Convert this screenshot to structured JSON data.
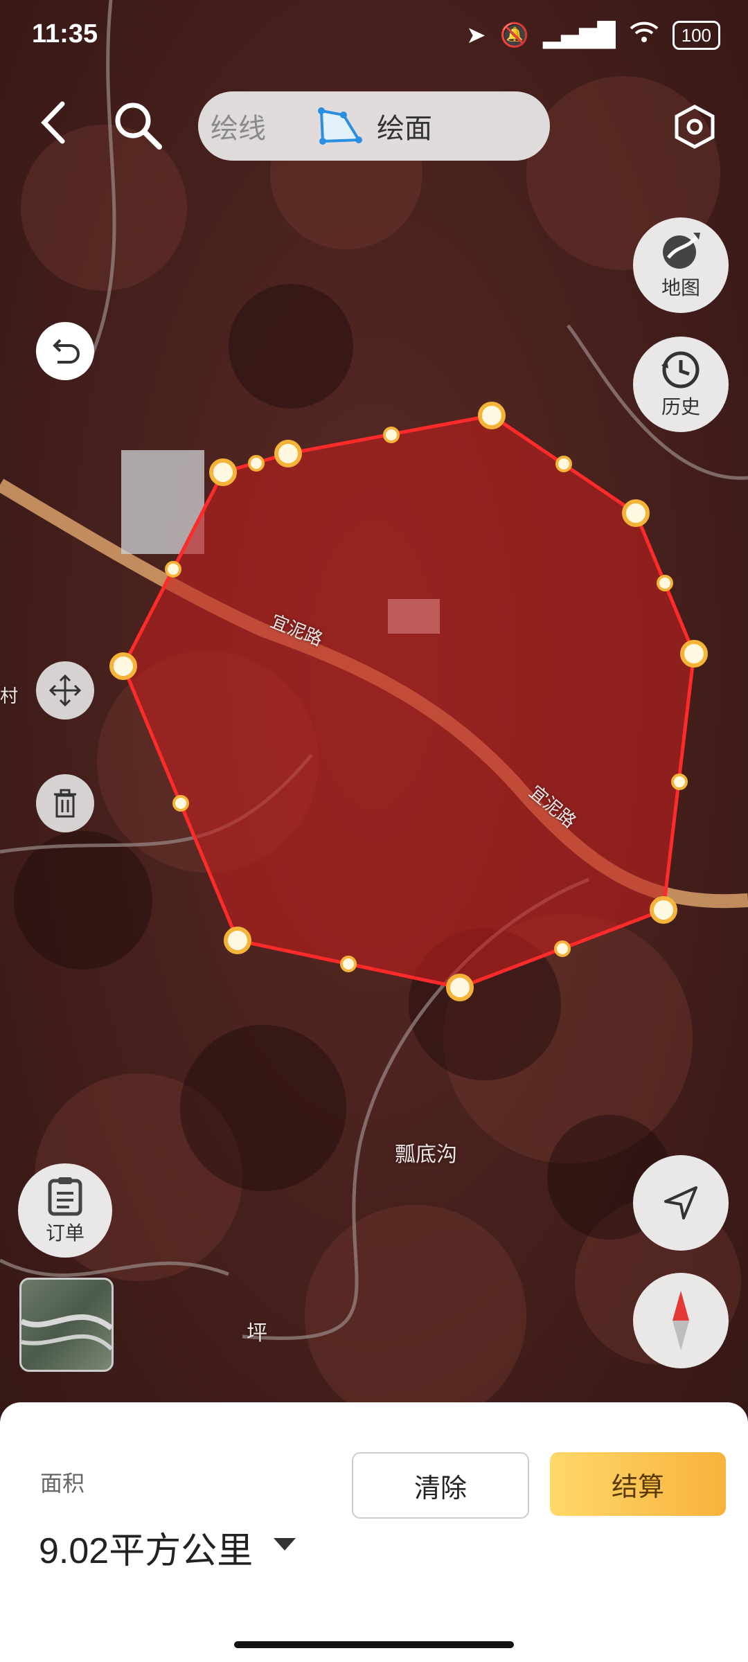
{
  "status": {
    "time": "11:35",
    "battery": "100"
  },
  "topbar": {
    "draw_line": "绘线",
    "draw_area": "绘面"
  },
  "right_controls": {
    "map_label": "地图",
    "history_label": "历史"
  },
  "left_controls": {
    "order_label": "订单"
  },
  "map": {
    "road_label": "宜泥路",
    "road_label_2": "宜泥路",
    "place_label": "瓢底沟",
    "place_label_2": "坪",
    "edge_label": "村"
  },
  "bottom": {
    "area_label": "面积",
    "area_value": "9.02平方公里",
    "clear_button": "清除",
    "pay_button": "结算"
  },
  "colors": {
    "polygon_fill": "#c0201e",
    "polygon_stroke": "#ff2a2a",
    "accent": "#f8b23c"
  }
}
